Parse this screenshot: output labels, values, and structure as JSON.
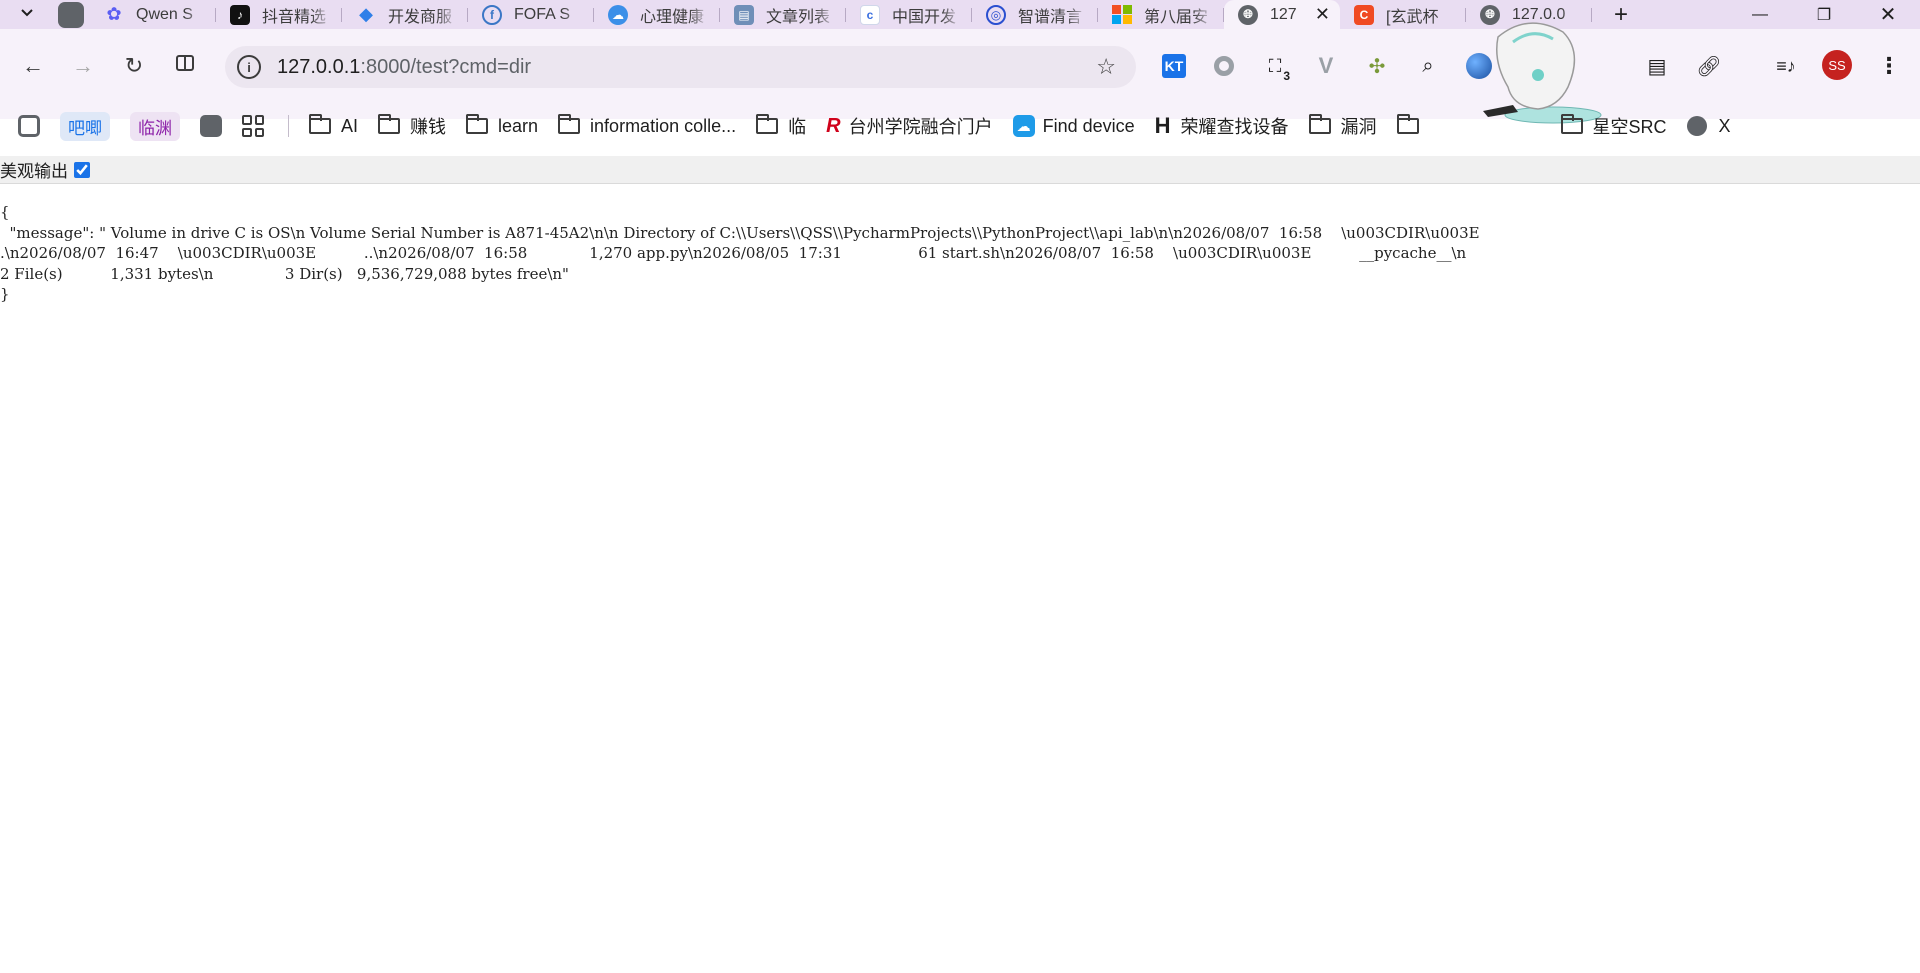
{
  "tabs": [
    {
      "title": "Qwen S",
      "icon": "qwen-icon",
      "color": "#5b5ef3"
    },
    {
      "title": "抖音精选",
      "icon": "douyin-icon",
      "color": "#111111"
    },
    {
      "title": "开发商服",
      "icon": "bird-icon",
      "color": "#2f7fe8"
    },
    {
      "title": "FOFA S",
      "icon": "fofa-icon",
      "color": "#3b77c6"
    },
    {
      "title": "心理健康",
      "icon": "cloud-icon",
      "color": "#3b8fe8"
    },
    {
      "title": "文章列表",
      "icon": "doc-icon",
      "color": "#6f8fb8"
    },
    {
      "title": "中国开发",
      "icon": "c-icon",
      "color": "#3a6fe0"
    },
    {
      "title": "智谱清言",
      "icon": "zhipu-icon",
      "color": "#2a4fd0"
    },
    {
      "title": "第八届安",
      "icon": "windows-icon",
      "color": "#f25022"
    },
    {
      "title": "127",
      "icon": "globe-icon",
      "color": "#5f6368",
      "active": true
    },
    {
      "title": "[玄武杯",
      "icon": "c-red-icon",
      "color": "#f04a23"
    },
    {
      "title": "127.0.0",
      "icon": "globe-icon",
      "color": "#5f6368"
    }
  ],
  "omnibox": {
    "host": "127.0.0.1",
    "rest": ":8000/test?cmd=dir"
  },
  "extensions": {
    "kt_label": "KT",
    "badge_count": "3"
  },
  "profile": {
    "initials": "SS"
  },
  "bookmarks": {
    "chip1": "吧唧",
    "chip2": "临渊",
    "items": [
      "AI",
      "赚钱",
      "learn",
      "information colle...",
      "临",
      "台州学院融合门户",
      "Find device",
      "荣耀查找设备",
      "漏洞",
      "星空SRC",
      "X"
    ]
  },
  "page": {
    "pretty_label": "美观输出",
    "pretty_checked": true,
    "json_text": "{\n  \"message\": \" Volume in drive C is OS\\n Volume Serial Number is A871-45A2\\n\\n Directory of C:\\\\Users\\\\QSS\\\\PycharmProjects\\\\PythonProject\\\\api_lab\\n\\n2026/08/07  16:58    \\u003CDIR\\u003E\n.\\n2026/08/07  16:47    \\u003CDIR\\u003E          ..\\n2026/08/07  16:58             1,270 app.py\\n2026/08/05  17:31                61 start.sh\\n2026/08/07  16:58    \\u003CDIR\\u003E          __pycache__\\n\n2 File(s)          1,331 bytes\\n               3 Dir(s)   9,536,729,088 bytes free\\n\"\n}"
  }
}
